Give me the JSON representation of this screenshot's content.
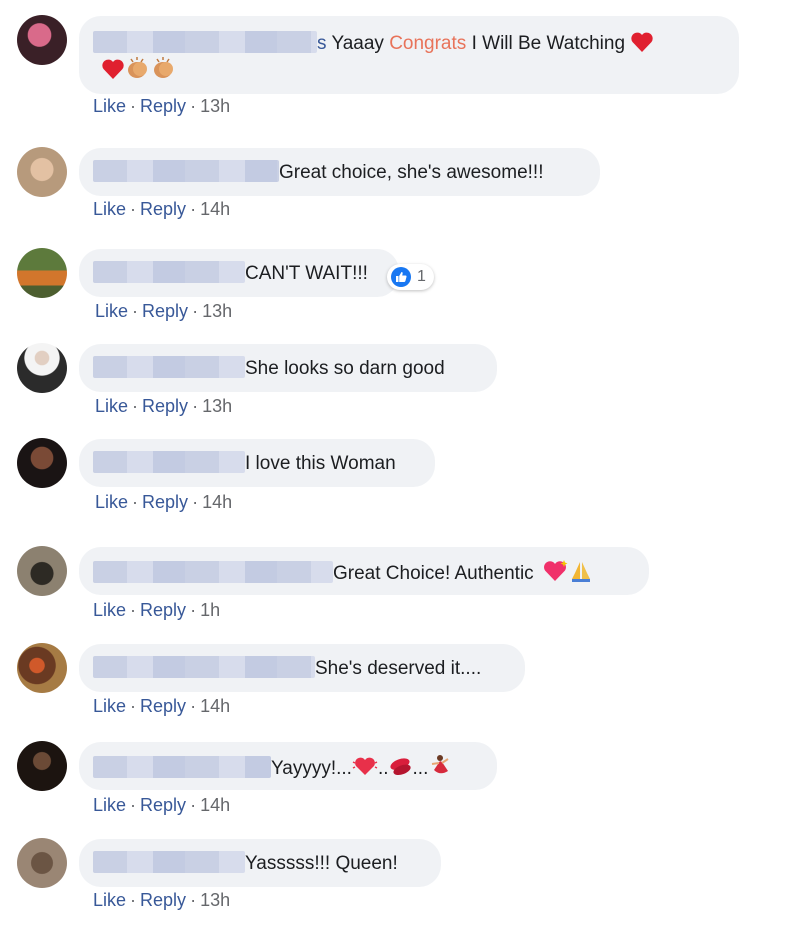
{
  "comments": [
    {
      "name_tail": "s",
      "text_before": "Yaaay ",
      "accent": "Congrats",
      "text_after": " I Will Be Watching",
      "emojis_line1": [
        "heart-icon"
      ],
      "emojis_line2": [
        "heart-icon",
        "clapping-hands-icon",
        "clapping-hands-icon"
      ],
      "actions": {
        "like": "Like",
        "reply": "Reply",
        "time": "13h"
      }
    },
    {
      "text": "Great choice, she's awesome!!!",
      "actions": {
        "like": "Like",
        "reply": "Reply",
        "time": "14h"
      }
    },
    {
      "text": "CAN'T WAIT!!!",
      "reaction": {
        "type": "like",
        "count": "1"
      },
      "actions": {
        "like": "Like",
        "reply": "Reply",
        "time": "13h"
      }
    },
    {
      "text": "She looks so darn good",
      "actions": {
        "like": "Like",
        "reply": "Reply",
        "time": "13h"
      }
    },
    {
      "text": "I love this Woman",
      "actions": {
        "like": "Like",
        "reply": "Reply",
        "time": "14h"
      }
    },
    {
      "text": "Great Choice! Authentic",
      "emojis": [
        "sparkling-heart-icon",
        "folded-hands-icon"
      ],
      "actions": {
        "like": "Like",
        "reply": "Reply",
        "time": "1h"
      }
    },
    {
      "text": "She's deserved it....",
      "actions": {
        "like": "Like",
        "reply": "Reply",
        "time": "14h"
      }
    },
    {
      "text_parts": [
        "Yayyyy!...",
        "..",
        "..."
      ],
      "emojis": [
        "beating-heart-icon",
        "kiss-mark-icon",
        "dancer-icon"
      ],
      "actions": {
        "like": "Like",
        "reply": "Reply",
        "time": "14h"
      }
    },
    {
      "text": "Yasssss!!! Queen!",
      "actions": {
        "like": "Like",
        "reply": "Reply",
        "time": "13h"
      }
    }
  ],
  "separator": "·",
  "colors": {
    "bubble": "#f0f2f5",
    "link": "#385898",
    "meta": "#65676b",
    "accent": "#e8735a",
    "like_blue": "#1877f2"
  }
}
